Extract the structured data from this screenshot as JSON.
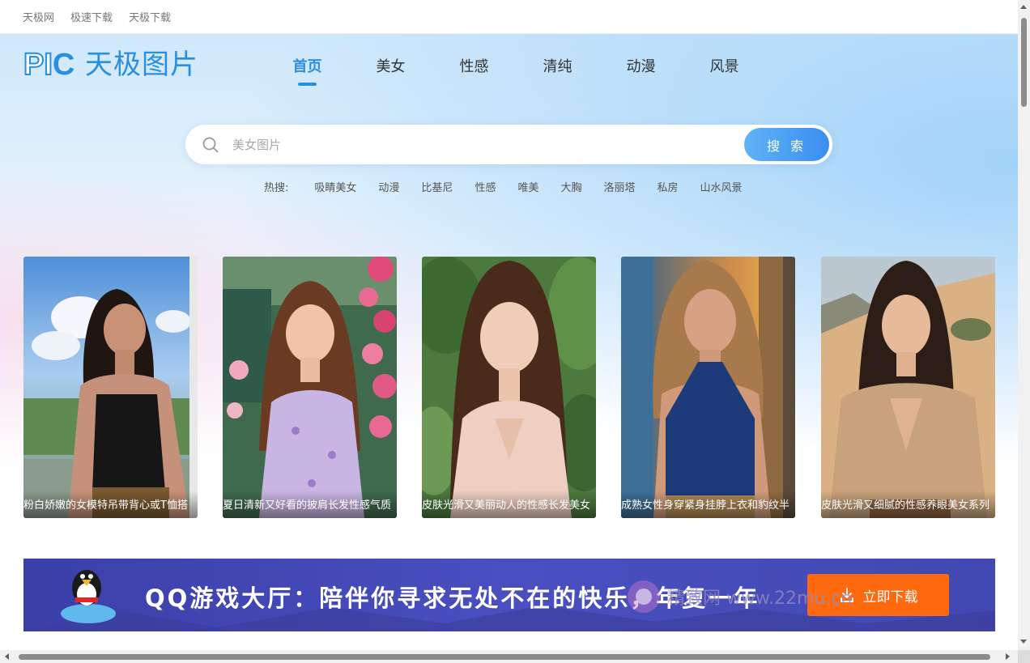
{
  "topbar": {
    "links": [
      "天极网",
      "极速下载",
      "天极下载"
    ]
  },
  "logo": {
    "mark": "PIC",
    "text": "天极图片"
  },
  "nav": {
    "items": [
      "首页",
      "美女",
      "性感",
      "清纯",
      "动漫",
      "风景"
    ],
    "active": "首页"
  },
  "search": {
    "placeholder": "美女图片",
    "value": "",
    "button_label": "搜 索",
    "icon": "search-icon"
  },
  "hot_search": {
    "label": "热搜:",
    "items": [
      "吸睛美女",
      "动漫",
      "比基尼",
      "性感",
      "唯美",
      "大胸",
      "洛丽塔",
      "私房",
      "山水风景"
    ]
  },
  "cards": [
    {
      "caption": "粉白娇嫩的女模特吊带背心或T恤搭",
      "theme": "sky"
    },
    {
      "caption": "夏日清新又好看的披肩长发性感气质",
      "theme": "flowers"
    },
    {
      "caption": "皮肤光滑又美丽动人的性感长发美女",
      "theme": "leaves"
    },
    {
      "caption": "成熟女性身穿紧身挂脖上衣和豹纹半",
      "theme": "city"
    },
    {
      "caption": "皮肤光滑又细腻的性感养眼美女系列",
      "theme": "desert"
    }
  ],
  "banner": {
    "text": "QQ游戏大厅：陪伴你寻求无处不在的快乐，年复一年",
    "button_label": "立即下载",
    "icon": "download-icon"
  },
  "watermark": {
    "text": "精致网 www.22mu.cn"
  },
  "colors": {
    "accent": "#2a8fe0",
    "search_button": "#3a8ef0",
    "banner_bg": "#4248b2",
    "banner_button": "#ff6a10"
  }
}
